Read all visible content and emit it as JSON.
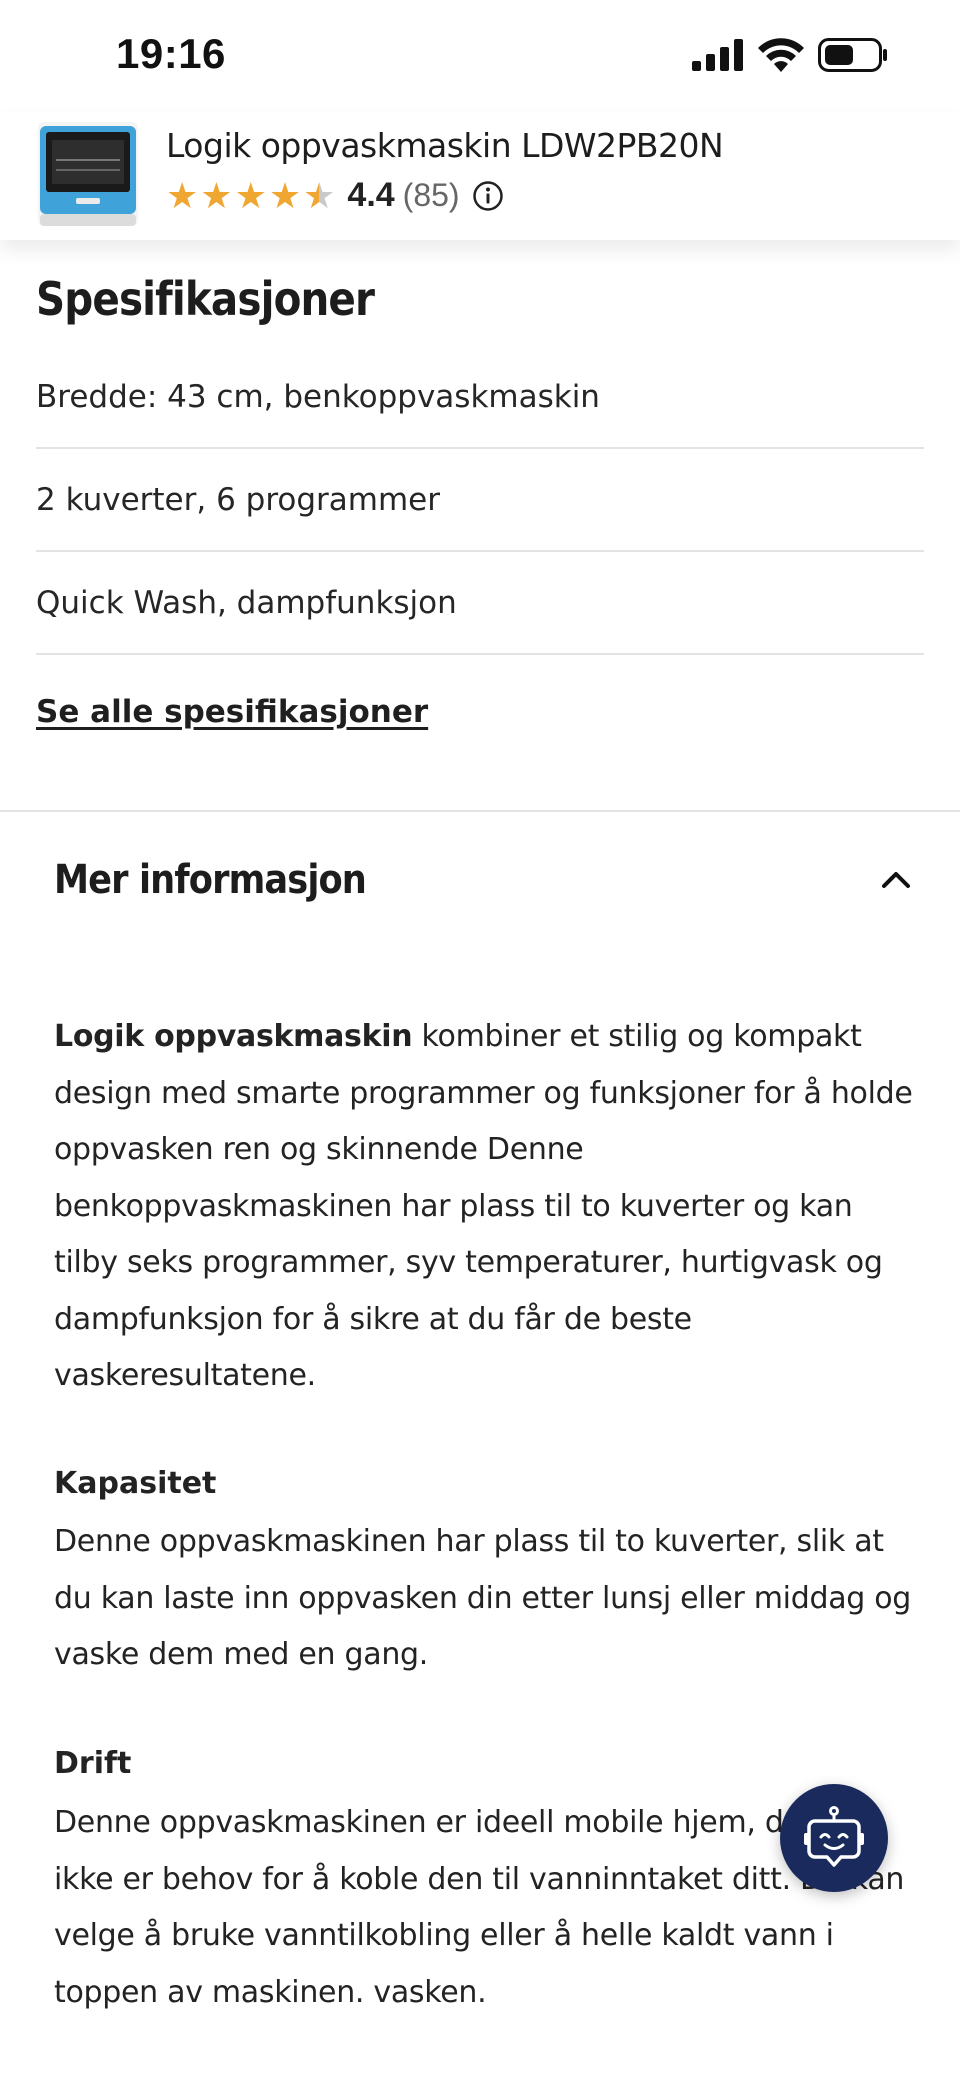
{
  "status_bar": {
    "time": "19:16",
    "icons": [
      "cellular-signal-icon",
      "wifi-icon",
      "battery-icon"
    ]
  },
  "product": {
    "title": "Logik oppvaskmaskin LDW2PB20N",
    "rating": "4.4",
    "rating_fraction": 0.88,
    "review_count": "(85)",
    "star_color": "#f0a732"
  },
  "specs": {
    "title": "Spesifikasjoner",
    "items": [
      "Bredde: 43 cm, benkoppvaskmaskin",
      "2 kuverter, 6 programmer",
      "Quick Wash, dampfunksjon"
    ],
    "see_all_link": "Se alle spesifikasjoner"
  },
  "more_info": {
    "title": "Mer informasjon",
    "intro_bold": "Logik oppvaskmaskin",
    "intro_text": " kombiner et stilig og kompakt design med smarte programmer og funksjoner for å holde oppvasken ren og skinnende Denne benkoppvaskmaskinen har plass til to kuverter og kan tilby seks programmer, syv temperaturer, hurtigvask og dampfunksjon for å sikre at du får de beste vaskeresultatene.",
    "capacity_heading": "Kapasitet",
    "capacity_text": "Denne oppvaskmaskinen har plass til to kuverter, slik at du kan laste inn oppvasken din etter lunsj eller middag og vaske dem med en gang.",
    "operation_heading": "Drift",
    "operation_text": "Denne oppvaskmaskinen er ideell mobile hjem, da det ikke er behov for å koble den til vanninntaket ditt. Du kan velge å bruke vanntilkobling eller å helle kaldt vann i toppen av maskinen. vasken."
  },
  "chat": {
    "icon": "chatbot-icon",
    "background": "#1b2a5c"
  }
}
